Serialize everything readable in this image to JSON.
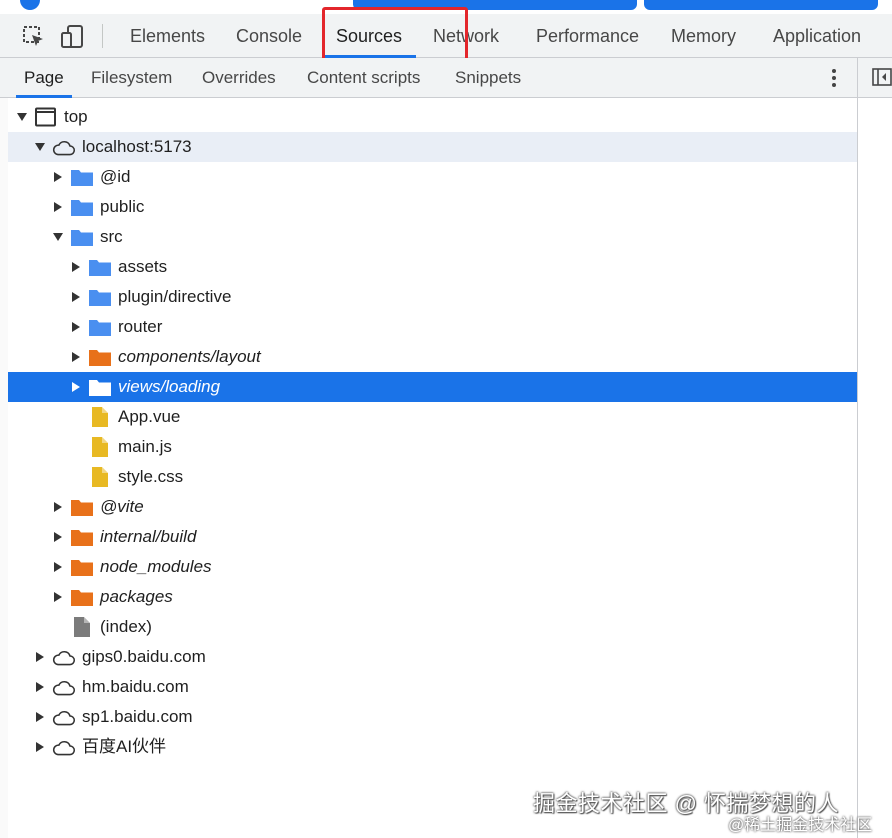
{
  "colors": {
    "accent": "#1a73e8",
    "highlight_box": "#e3262b",
    "folder_blue": "#4a8ff0",
    "folder_orange": "#e8711a",
    "file_yellow": "#e8b923",
    "file_gray": "#7b7b7b"
  },
  "toolbar": {
    "icons": [
      "inspect-element-icon",
      "device-toolbar-icon"
    ]
  },
  "main_tabs": [
    {
      "label": "Elements",
      "active": false
    },
    {
      "label": "Console",
      "active": false
    },
    {
      "label": "Sources",
      "active": true
    },
    {
      "label": "Network",
      "active": false
    },
    {
      "label": "Performance",
      "active": false
    },
    {
      "label": "Memory",
      "active": false
    },
    {
      "label": "Application",
      "active": false
    }
  ],
  "sub_tabs": [
    {
      "label": "Page",
      "active": true
    },
    {
      "label": "Filesystem",
      "active": false
    },
    {
      "label": "Overrides",
      "active": false
    },
    {
      "label": "Content scripts",
      "active": false
    },
    {
      "label": "Snippets",
      "active": false
    }
  ],
  "tree": [
    {
      "label": "top",
      "depth": 0,
      "arrow": "down",
      "icon": "frame-icon",
      "italic": false,
      "state": "normal"
    },
    {
      "label": "localhost:5173",
      "depth": 1,
      "arrow": "down",
      "icon": "cloud-icon",
      "italic": false,
      "state": "hover"
    },
    {
      "label": "@id",
      "depth": 2,
      "arrow": "right",
      "icon": "folder-blue-icon",
      "italic": false,
      "state": "normal"
    },
    {
      "label": "public",
      "depth": 2,
      "arrow": "right",
      "icon": "folder-blue-icon",
      "italic": false,
      "state": "normal"
    },
    {
      "label": "src",
      "depth": 2,
      "arrow": "down",
      "icon": "folder-blue-icon",
      "italic": false,
      "state": "normal"
    },
    {
      "label": "assets",
      "depth": 3,
      "arrow": "right",
      "icon": "folder-blue-icon",
      "italic": false,
      "state": "normal"
    },
    {
      "label": "plugin/directive",
      "depth": 3,
      "arrow": "right",
      "icon": "folder-blue-icon",
      "italic": false,
      "state": "normal"
    },
    {
      "label": "router",
      "depth": 3,
      "arrow": "right",
      "icon": "folder-blue-icon",
      "italic": false,
      "state": "normal"
    },
    {
      "label": "components/layout",
      "depth": 3,
      "arrow": "right",
      "icon": "folder-orange-icon",
      "italic": true,
      "state": "normal"
    },
    {
      "label": "views/loading",
      "depth": 3,
      "arrow": "right",
      "icon": "folder-white-icon",
      "italic": true,
      "state": "selected"
    },
    {
      "label": "App.vue",
      "depth": 3,
      "arrow": "none",
      "icon": "file-yellow-icon",
      "italic": false,
      "state": "normal"
    },
    {
      "label": "main.js",
      "depth": 3,
      "arrow": "none",
      "icon": "file-yellow-icon",
      "italic": false,
      "state": "normal"
    },
    {
      "label": "style.css",
      "depth": 3,
      "arrow": "none",
      "icon": "file-yellow-icon",
      "italic": false,
      "state": "normal"
    },
    {
      "label": "@vite",
      "depth": 2,
      "arrow": "right",
      "icon": "folder-orange-icon",
      "italic": true,
      "state": "normal"
    },
    {
      "label": "internal/build",
      "depth": 2,
      "arrow": "right",
      "icon": "folder-orange-icon",
      "italic": true,
      "state": "normal"
    },
    {
      "label": "node_modules",
      "depth": 2,
      "arrow": "right",
      "icon": "folder-orange-icon",
      "italic": true,
      "state": "normal"
    },
    {
      "label": "packages",
      "depth": 2,
      "arrow": "right",
      "icon": "folder-orange-icon",
      "italic": true,
      "state": "normal"
    },
    {
      "label": "(index)",
      "depth": 2,
      "arrow": "none",
      "icon": "file-gray-icon",
      "italic": false,
      "state": "normal"
    },
    {
      "label": "gips0.baidu.com",
      "depth": 1,
      "arrow": "right",
      "icon": "cloud-icon",
      "italic": false,
      "state": "normal"
    },
    {
      "label": "hm.baidu.com",
      "depth": 1,
      "arrow": "right",
      "icon": "cloud-icon",
      "italic": false,
      "state": "normal"
    },
    {
      "label": "sp1.baidu.com",
      "depth": 1,
      "arrow": "right",
      "icon": "cloud-icon",
      "italic": false,
      "state": "normal"
    },
    {
      "label": "百度AI伙伴",
      "depth": 1,
      "arrow": "right",
      "icon": "cloud-icon",
      "italic": false,
      "state": "normal"
    }
  ],
  "watermark": {
    "line1": "掘金技术社区 @ 怀揣梦想的人",
    "line2": "@稀土掘金技术社区"
  }
}
